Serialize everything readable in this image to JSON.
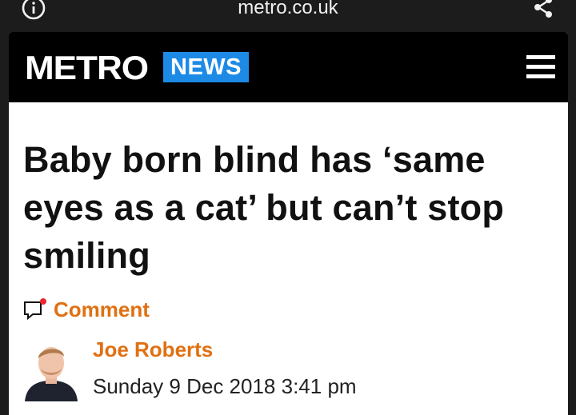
{
  "browser": {
    "url": "metro.co.uk",
    "info_icon": "info-icon",
    "share_icon": "share-icon"
  },
  "header": {
    "logo": "METRO",
    "section": "NEWS",
    "menu_icon": "hamburger-menu-icon",
    "section_color": "#1d8ae6"
  },
  "article": {
    "headline": "Baby born blind has ‘same eyes as a cat’ but can’t stop smiling",
    "comment_label": "Comment",
    "author": "Joe Roberts",
    "date": "Sunday 9 Dec 2018 3:41 pm",
    "accent_color": "#e07011"
  }
}
